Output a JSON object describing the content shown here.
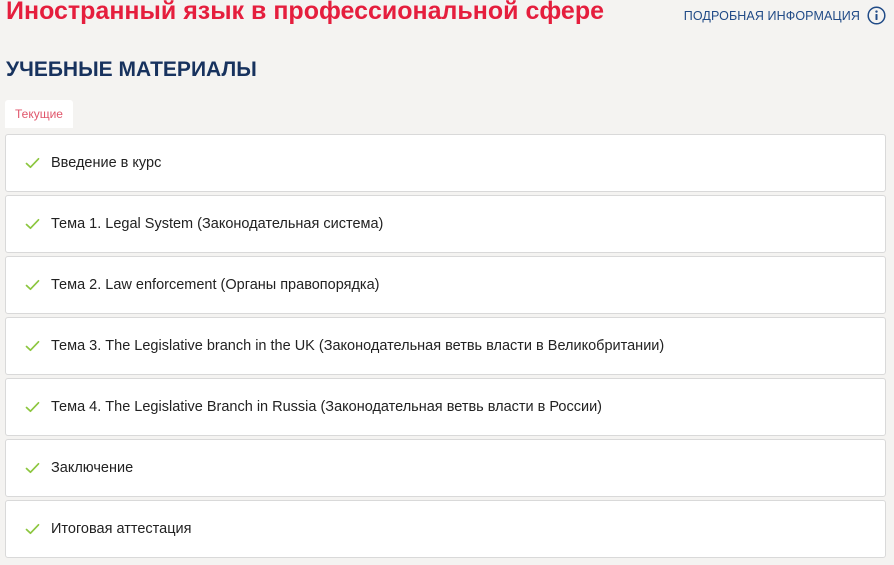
{
  "header": {
    "course_title": "Иностранный язык в профессиональной сфере",
    "info_link": "ПОДРОБНАЯ ИНФОРМАЦИЯ",
    "info_icon": "info-icon"
  },
  "section": {
    "title": "УЧЕБНЫЕ МАТЕРИАЛЫ"
  },
  "tabs": [
    {
      "label": "Текущие",
      "active": true
    }
  ],
  "modules": [
    {
      "label": "Введение в курс",
      "completed": true
    },
    {
      "label": "Тема 1. Legal System (Законодательная система)",
      "completed": true
    },
    {
      "label": "Тема 2. Law enforcement (Органы правопорядка)",
      "completed": true
    },
    {
      "label": "Тема 3. The Legislative branch in the UK (Законодательная ветвь власти в Великобритании)",
      "completed": true
    },
    {
      "label": "Тема 4. The Legislative Branch in Russia (Законодательная ветвь власти в России)",
      "completed": true
    },
    {
      "label": "Заключение",
      "completed": true
    },
    {
      "label": "Итоговая аттестация",
      "completed": true
    }
  ],
  "colors": {
    "title_red": "#e51e3d",
    "link_blue": "#214b87",
    "heading_navy": "#17325e",
    "check_green": "#8cc63f",
    "background": "#f4f3f1"
  }
}
